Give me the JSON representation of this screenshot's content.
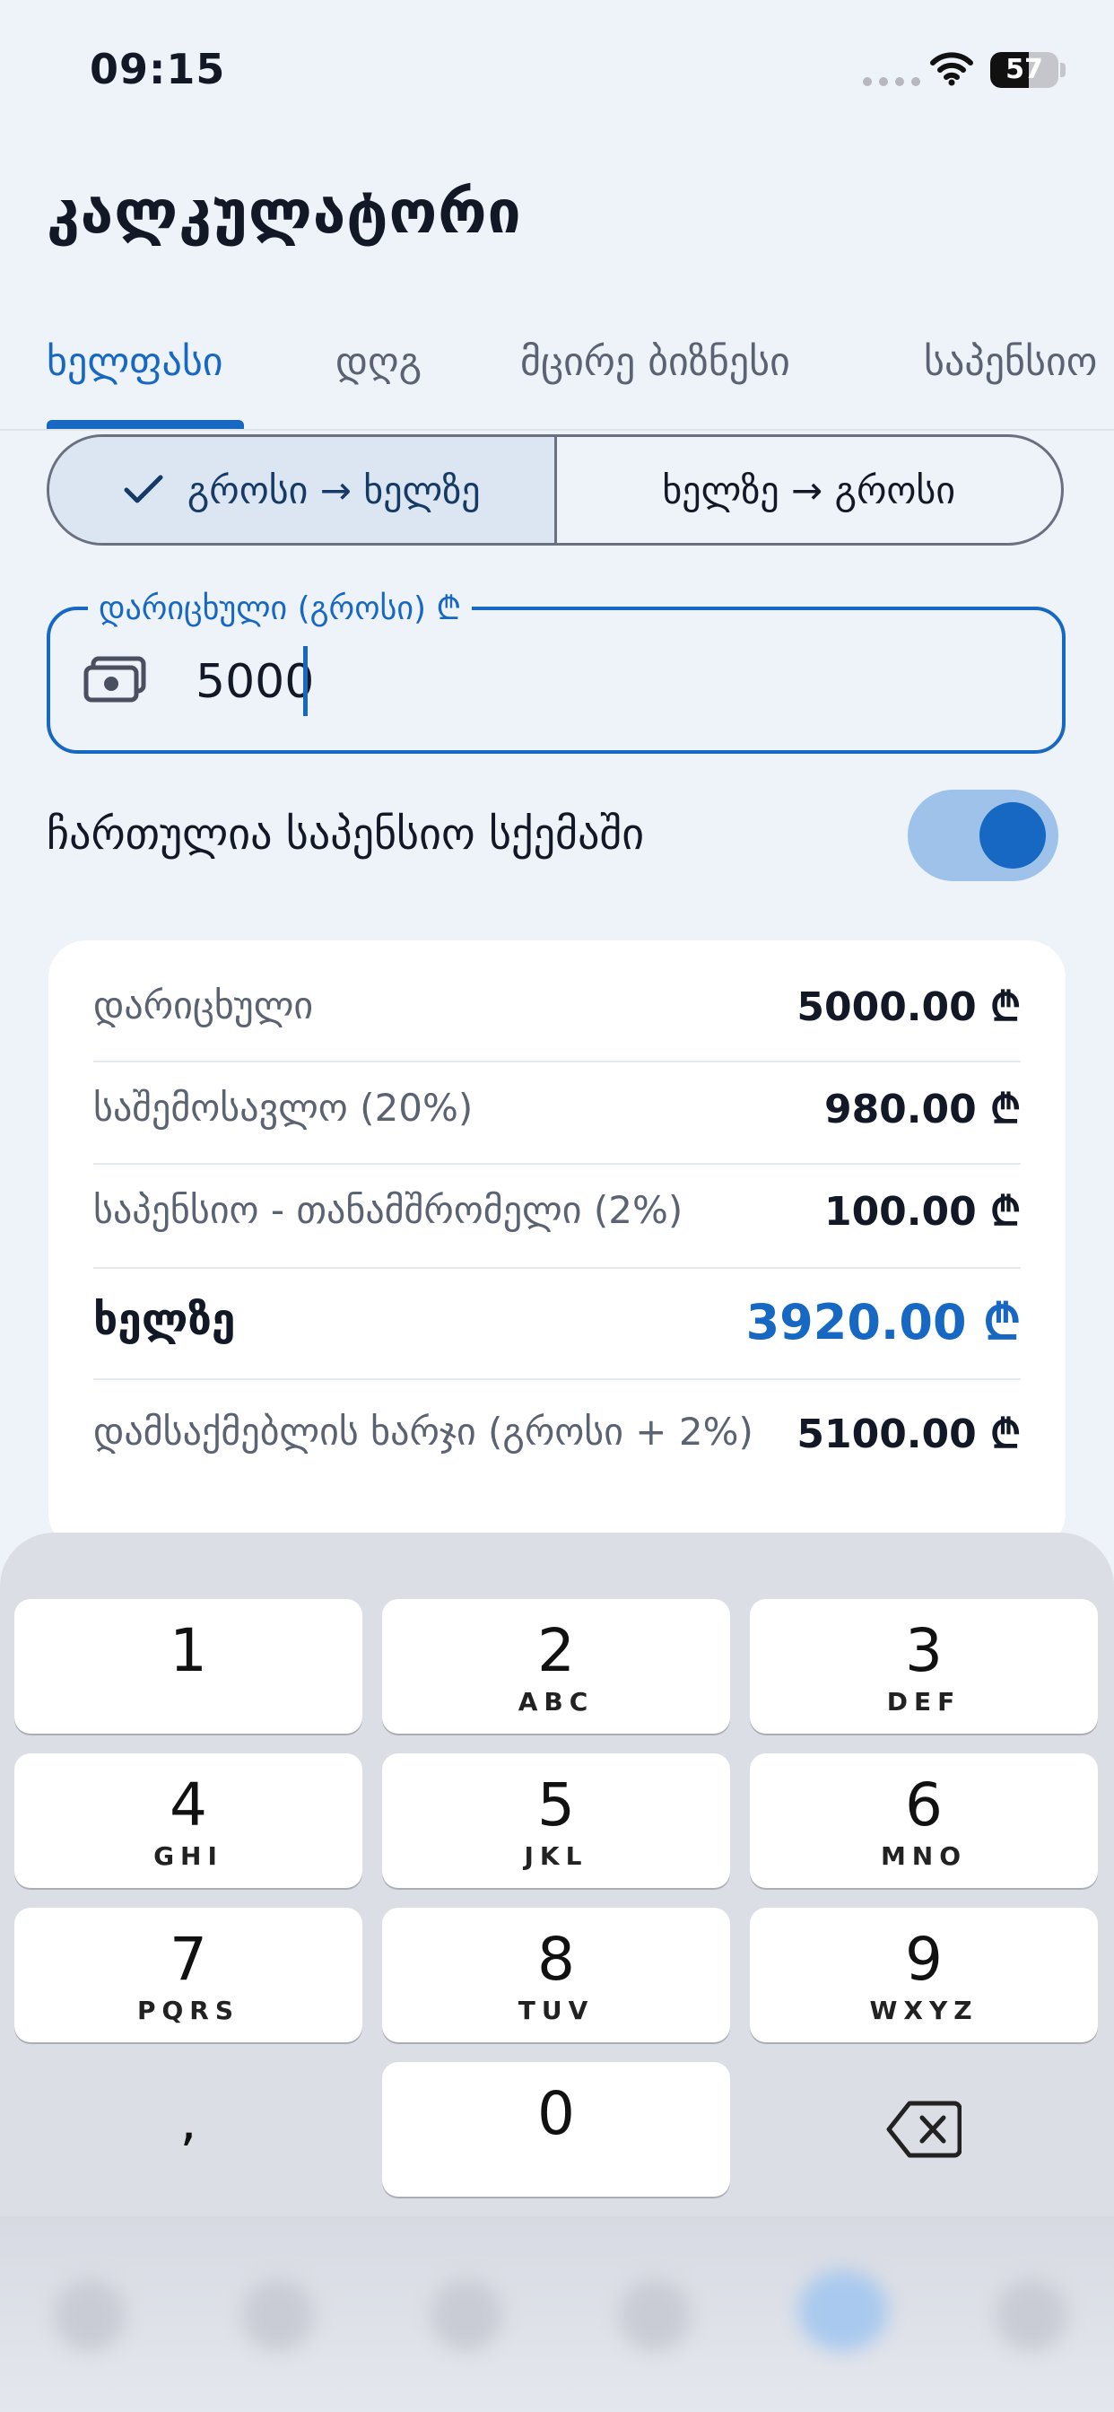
{
  "status": {
    "time": "09:15",
    "battery_level": "57"
  },
  "header": {
    "title": "კალკულატორი"
  },
  "tabs": [
    {
      "label": "ხელფასი",
      "active": true
    },
    {
      "label": "დღგ",
      "active": false
    },
    {
      "label": "მცირე ბიზნესი",
      "active": false
    },
    {
      "label": "საპენსიო",
      "active": false
    }
  ],
  "mode": {
    "gross_to_net": "გროსი → ხელზე",
    "net_to_gross": "ხელზე → გროსი",
    "selected": "gross_to_net"
  },
  "input": {
    "label": "დარიცხული (გროსი) ₾",
    "value": "5000"
  },
  "pension_toggle": {
    "label": "ჩართულია საპენსიო სქემაში",
    "on": true
  },
  "summary": {
    "rows": [
      {
        "label": "დარიცხული",
        "value": "5000.00 ₾"
      },
      {
        "label": "საშემოსავლო (20%)",
        "value": "980.00 ₾"
      },
      {
        "label": "საპენსიო - თანამშრომელი (2%)",
        "value": "100.00 ₾"
      },
      {
        "label": "ხელზე",
        "value": "3920.00 ₾"
      },
      {
        "label": "დამსაქმებლის ხარჯი (გროსი + 2%)",
        "value": "5100.00 ₾"
      }
    ]
  },
  "keypad": {
    "keys": [
      {
        "num": "1",
        "letters": ""
      },
      {
        "num": "2",
        "letters": "ABC"
      },
      {
        "num": "3",
        "letters": "DEF"
      },
      {
        "num": "4",
        "letters": "GHI"
      },
      {
        "num": "5",
        "letters": "JKL"
      },
      {
        "num": "6",
        "letters": "MNO"
      },
      {
        "num": "7",
        "letters": "PQRS"
      },
      {
        "num": "8",
        "letters": "TUV"
      },
      {
        "num": "9",
        "letters": "WXYZ"
      },
      {
        "num": ",",
        "letters": ""
      },
      {
        "num": "0",
        "letters": ""
      }
    ]
  },
  "colors": {
    "accent": "#1668c3",
    "background": "#eef2f9",
    "card": "#ffffff",
    "keyboard": "#dbdee5"
  }
}
